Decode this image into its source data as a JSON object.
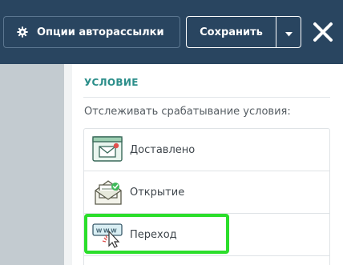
{
  "toolbar": {
    "options_label": "Опции авторассылки",
    "save_label": "Сохранить"
  },
  "panel": {
    "section_title": "УСЛОВИЕ",
    "instruction": "Отслеживать срабатывание условия:",
    "options": [
      {
        "label": "Доставлено",
        "icon": "envelope-delivered-icon"
      },
      {
        "label": "Открытие",
        "icon": "open-envelope-check-icon"
      },
      {
        "label": "Переход",
        "icon": "www-click-cursor-icon"
      }
    ],
    "highlighted_option": "Переход"
  },
  "colors": {
    "header_bg": "#294560",
    "accent_teal": "#2b8e8a",
    "highlight_green": "#2bde2b"
  }
}
